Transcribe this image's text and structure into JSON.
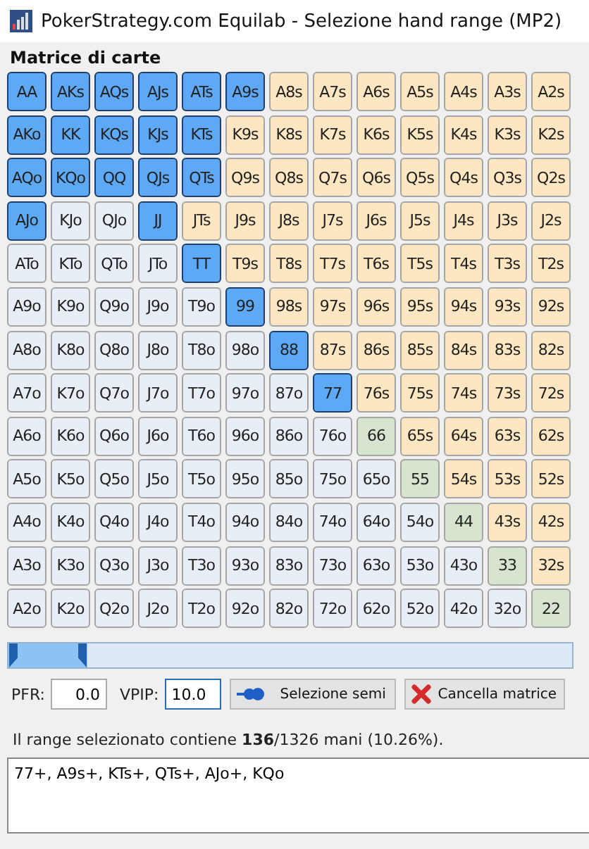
{
  "window": {
    "title": "PokerStrategy.com Equilab - Selezione hand range (MP2)"
  },
  "matrix": {
    "title": "Matrice di carte",
    "rows": [
      {
        "cells": [
          {
            "label": "AA",
            "kind": "pair",
            "selected": true
          },
          {
            "label": "AKs",
            "kind": "suited",
            "selected": true
          },
          {
            "label": "AQs",
            "kind": "suited",
            "selected": true
          },
          {
            "label": "AJs",
            "kind": "suited",
            "selected": true
          },
          {
            "label": "ATs",
            "kind": "suited",
            "selected": true
          },
          {
            "label": "A9s",
            "kind": "suited",
            "selected": true
          },
          {
            "label": "A8s",
            "kind": "suited",
            "selected": false
          },
          {
            "label": "A7s",
            "kind": "suited",
            "selected": false
          },
          {
            "label": "A6s",
            "kind": "suited",
            "selected": false
          },
          {
            "label": "A5s",
            "kind": "suited",
            "selected": false
          },
          {
            "label": "A4s",
            "kind": "suited",
            "selected": false
          },
          {
            "label": "A3s",
            "kind": "suited",
            "selected": false
          },
          {
            "label": "A2s",
            "kind": "suited",
            "selected": false
          }
        ]
      },
      {
        "cells": [
          {
            "label": "AKo",
            "kind": "offsuit",
            "selected": true
          },
          {
            "label": "KK",
            "kind": "pair",
            "selected": true
          },
          {
            "label": "KQs",
            "kind": "suited",
            "selected": true
          },
          {
            "label": "KJs",
            "kind": "suited",
            "selected": true
          },
          {
            "label": "KTs",
            "kind": "suited",
            "selected": true
          },
          {
            "label": "K9s",
            "kind": "suited",
            "selected": false
          },
          {
            "label": "K8s",
            "kind": "suited",
            "selected": false
          },
          {
            "label": "K7s",
            "kind": "suited",
            "selected": false
          },
          {
            "label": "K6s",
            "kind": "suited",
            "selected": false
          },
          {
            "label": "K5s",
            "kind": "suited",
            "selected": false
          },
          {
            "label": "K4s",
            "kind": "suited",
            "selected": false
          },
          {
            "label": "K3s",
            "kind": "suited",
            "selected": false
          },
          {
            "label": "K2s",
            "kind": "suited",
            "selected": false
          }
        ]
      },
      {
        "cells": [
          {
            "label": "AQo",
            "kind": "offsuit",
            "selected": true
          },
          {
            "label": "KQo",
            "kind": "offsuit",
            "selected": true
          },
          {
            "label": "QQ",
            "kind": "pair",
            "selected": true
          },
          {
            "label": "QJs",
            "kind": "suited",
            "selected": true
          },
          {
            "label": "QTs",
            "kind": "suited",
            "selected": true
          },
          {
            "label": "Q9s",
            "kind": "suited",
            "selected": false
          },
          {
            "label": "Q8s",
            "kind": "suited",
            "selected": false
          },
          {
            "label": "Q7s",
            "kind": "suited",
            "selected": false
          },
          {
            "label": "Q6s",
            "kind": "suited",
            "selected": false
          },
          {
            "label": "Q5s",
            "kind": "suited",
            "selected": false
          },
          {
            "label": "Q4s",
            "kind": "suited",
            "selected": false
          },
          {
            "label": "Q3s",
            "kind": "suited",
            "selected": false
          },
          {
            "label": "Q2s",
            "kind": "suited",
            "selected": false
          }
        ]
      },
      {
        "cells": [
          {
            "label": "AJo",
            "kind": "offsuit",
            "selected": true
          },
          {
            "label": "KJo",
            "kind": "offsuit",
            "selected": false
          },
          {
            "label": "QJo",
            "kind": "offsuit",
            "selected": false
          },
          {
            "label": "JJ",
            "kind": "pair",
            "selected": true
          },
          {
            "label": "JTs",
            "kind": "suited",
            "selected": false
          },
          {
            "label": "J9s",
            "kind": "suited",
            "selected": false
          },
          {
            "label": "J8s",
            "kind": "suited",
            "selected": false
          },
          {
            "label": "J7s",
            "kind": "suited",
            "selected": false
          },
          {
            "label": "J6s",
            "kind": "suited",
            "selected": false
          },
          {
            "label": "J5s",
            "kind": "suited",
            "selected": false
          },
          {
            "label": "J4s",
            "kind": "suited",
            "selected": false
          },
          {
            "label": "J3s",
            "kind": "suited",
            "selected": false
          },
          {
            "label": "J2s",
            "kind": "suited",
            "selected": false
          }
        ]
      },
      {
        "cells": [
          {
            "label": "ATo",
            "kind": "offsuit",
            "selected": false
          },
          {
            "label": "KTo",
            "kind": "offsuit",
            "selected": false
          },
          {
            "label": "QTo",
            "kind": "offsuit",
            "selected": false
          },
          {
            "label": "JTo",
            "kind": "offsuit",
            "selected": false
          },
          {
            "label": "TT",
            "kind": "pair",
            "selected": true
          },
          {
            "label": "T9s",
            "kind": "suited",
            "selected": false
          },
          {
            "label": "T8s",
            "kind": "suited",
            "selected": false
          },
          {
            "label": "T7s",
            "kind": "suited",
            "selected": false
          },
          {
            "label": "T6s",
            "kind": "suited",
            "selected": false
          },
          {
            "label": "T5s",
            "kind": "suited",
            "selected": false
          },
          {
            "label": "T4s",
            "kind": "suited",
            "selected": false
          },
          {
            "label": "T3s",
            "kind": "suited",
            "selected": false
          },
          {
            "label": "T2s",
            "kind": "suited",
            "selected": false
          }
        ]
      },
      {
        "cells": [
          {
            "label": "A9o",
            "kind": "offsuit",
            "selected": false
          },
          {
            "label": "K9o",
            "kind": "offsuit",
            "selected": false
          },
          {
            "label": "Q9o",
            "kind": "offsuit",
            "selected": false
          },
          {
            "label": "J9o",
            "kind": "offsuit",
            "selected": false
          },
          {
            "label": "T9o",
            "kind": "offsuit",
            "selected": false
          },
          {
            "label": "99",
            "kind": "pair",
            "selected": true
          },
          {
            "label": "98s",
            "kind": "suited",
            "selected": false
          },
          {
            "label": "97s",
            "kind": "suited",
            "selected": false
          },
          {
            "label": "96s",
            "kind": "suited",
            "selected": false
          },
          {
            "label": "95s",
            "kind": "suited",
            "selected": false
          },
          {
            "label": "94s",
            "kind": "suited",
            "selected": false
          },
          {
            "label": "93s",
            "kind": "suited",
            "selected": false
          },
          {
            "label": "92s",
            "kind": "suited",
            "selected": false
          }
        ]
      },
      {
        "cells": [
          {
            "label": "A8o",
            "kind": "offsuit",
            "selected": false
          },
          {
            "label": "K8o",
            "kind": "offsuit",
            "selected": false
          },
          {
            "label": "Q8o",
            "kind": "offsuit",
            "selected": false
          },
          {
            "label": "J8o",
            "kind": "offsuit",
            "selected": false
          },
          {
            "label": "T8o",
            "kind": "offsuit",
            "selected": false
          },
          {
            "label": "98o",
            "kind": "offsuit",
            "selected": false
          },
          {
            "label": "88",
            "kind": "pair",
            "selected": true
          },
          {
            "label": "87s",
            "kind": "suited",
            "selected": false
          },
          {
            "label": "86s",
            "kind": "suited",
            "selected": false
          },
          {
            "label": "85s",
            "kind": "suited",
            "selected": false
          },
          {
            "label": "84s",
            "kind": "suited",
            "selected": false
          },
          {
            "label": "83s",
            "kind": "suited",
            "selected": false
          },
          {
            "label": "82s",
            "kind": "suited",
            "selected": false
          }
        ]
      },
      {
        "cells": [
          {
            "label": "A7o",
            "kind": "offsuit",
            "selected": false
          },
          {
            "label": "K7o",
            "kind": "offsuit",
            "selected": false
          },
          {
            "label": "Q7o",
            "kind": "offsuit",
            "selected": false
          },
          {
            "label": "J7o",
            "kind": "offsuit",
            "selected": false
          },
          {
            "label": "T7o",
            "kind": "offsuit",
            "selected": false
          },
          {
            "label": "97o",
            "kind": "offsuit",
            "selected": false
          },
          {
            "label": "87o",
            "kind": "offsuit",
            "selected": false
          },
          {
            "label": "77",
            "kind": "pair",
            "selected": true
          },
          {
            "label": "76s",
            "kind": "suited",
            "selected": false
          },
          {
            "label": "75s",
            "kind": "suited",
            "selected": false
          },
          {
            "label": "74s",
            "kind": "suited",
            "selected": false
          },
          {
            "label": "73s",
            "kind": "suited",
            "selected": false
          },
          {
            "label": "72s",
            "kind": "suited",
            "selected": false
          }
        ]
      },
      {
        "cells": [
          {
            "label": "A6o",
            "kind": "offsuit",
            "selected": false
          },
          {
            "label": "K6o",
            "kind": "offsuit",
            "selected": false
          },
          {
            "label": "Q6o",
            "kind": "offsuit",
            "selected": false
          },
          {
            "label": "J6o",
            "kind": "offsuit",
            "selected": false
          },
          {
            "label": "T6o",
            "kind": "offsuit",
            "selected": false
          },
          {
            "label": "96o",
            "kind": "offsuit",
            "selected": false
          },
          {
            "label": "86o",
            "kind": "offsuit",
            "selected": false
          },
          {
            "label": "76o",
            "kind": "offsuit",
            "selected": false
          },
          {
            "label": "66",
            "kind": "pair",
            "selected": false
          },
          {
            "label": "65s",
            "kind": "suited",
            "selected": false
          },
          {
            "label": "64s",
            "kind": "suited",
            "selected": false
          },
          {
            "label": "63s",
            "kind": "suited",
            "selected": false
          },
          {
            "label": "62s",
            "kind": "suited",
            "selected": false
          }
        ]
      },
      {
        "cells": [
          {
            "label": "A5o",
            "kind": "offsuit",
            "selected": false
          },
          {
            "label": "K5o",
            "kind": "offsuit",
            "selected": false
          },
          {
            "label": "Q5o",
            "kind": "offsuit",
            "selected": false
          },
          {
            "label": "J5o",
            "kind": "offsuit",
            "selected": false
          },
          {
            "label": "T5o",
            "kind": "offsuit",
            "selected": false
          },
          {
            "label": "95o",
            "kind": "offsuit",
            "selected": false
          },
          {
            "label": "85o",
            "kind": "offsuit",
            "selected": false
          },
          {
            "label": "75o",
            "kind": "offsuit",
            "selected": false
          },
          {
            "label": "65o",
            "kind": "offsuit",
            "selected": false
          },
          {
            "label": "55",
            "kind": "pair",
            "selected": false
          },
          {
            "label": "54s",
            "kind": "suited",
            "selected": false
          },
          {
            "label": "53s",
            "kind": "suited",
            "selected": false
          },
          {
            "label": "52s",
            "kind": "suited",
            "selected": false
          }
        ]
      },
      {
        "cells": [
          {
            "label": "A4o",
            "kind": "offsuit",
            "selected": false
          },
          {
            "label": "K4o",
            "kind": "offsuit",
            "selected": false
          },
          {
            "label": "Q4o",
            "kind": "offsuit",
            "selected": false
          },
          {
            "label": "J4o",
            "kind": "offsuit",
            "selected": false
          },
          {
            "label": "T4o",
            "kind": "offsuit",
            "selected": false
          },
          {
            "label": "94o",
            "kind": "offsuit",
            "selected": false
          },
          {
            "label": "84o",
            "kind": "offsuit",
            "selected": false
          },
          {
            "label": "74o",
            "kind": "offsuit",
            "selected": false
          },
          {
            "label": "64o",
            "kind": "offsuit",
            "selected": false
          },
          {
            "label": "54o",
            "kind": "offsuit",
            "selected": false
          },
          {
            "label": "44",
            "kind": "pair",
            "selected": false
          },
          {
            "label": "43s",
            "kind": "suited",
            "selected": false
          },
          {
            "label": "42s",
            "kind": "suited",
            "selected": false
          }
        ]
      },
      {
        "cells": [
          {
            "label": "A3o",
            "kind": "offsuit",
            "selected": false
          },
          {
            "label": "K3o",
            "kind": "offsuit",
            "selected": false
          },
          {
            "label": "Q3o",
            "kind": "offsuit",
            "selected": false
          },
          {
            "label": "J3o",
            "kind": "offsuit",
            "selected": false
          },
          {
            "label": "T3o",
            "kind": "offsuit",
            "selected": false
          },
          {
            "label": "93o",
            "kind": "offsuit",
            "selected": false
          },
          {
            "label": "83o",
            "kind": "offsuit",
            "selected": false
          },
          {
            "label": "73o",
            "kind": "offsuit",
            "selected": false
          },
          {
            "label": "63o",
            "kind": "offsuit",
            "selected": false
          },
          {
            "label": "53o",
            "kind": "offsuit",
            "selected": false
          },
          {
            "label": "43o",
            "kind": "offsuit",
            "selected": false
          },
          {
            "label": "33",
            "kind": "pair",
            "selected": false
          },
          {
            "label": "32s",
            "kind": "suited",
            "selected": false
          }
        ]
      },
      {
        "cells": [
          {
            "label": "A2o",
            "kind": "offsuit",
            "selected": false
          },
          {
            "label": "K2o",
            "kind": "offsuit",
            "selected": false
          },
          {
            "label": "Q2o",
            "kind": "offsuit",
            "selected": false
          },
          {
            "label": "J2o",
            "kind": "offsuit",
            "selected": false
          },
          {
            "label": "T2o",
            "kind": "offsuit",
            "selected": false
          },
          {
            "label": "92o",
            "kind": "offsuit",
            "selected": false
          },
          {
            "label": "82o",
            "kind": "offsuit",
            "selected": false
          },
          {
            "label": "72o",
            "kind": "offsuit",
            "selected": false
          },
          {
            "label": "62o",
            "kind": "offsuit",
            "selected": false
          },
          {
            "label": "52o",
            "kind": "offsuit",
            "selected": false
          },
          {
            "label": "42o",
            "kind": "offsuit",
            "selected": false
          },
          {
            "label": "32o",
            "kind": "offsuit",
            "selected": false
          },
          {
            "label": "22",
            "kind": "pair",
            "selected": false
          }
        ]
      }
    ]
  },
  "slider": {
    "level": 0.14
  },
  "controls": {
    "pfr_label": "PFR:",
    "pfr_value": "0.0",
    "vpip_label": "VPIP:",
    "vpip_value": "10.0",
    "suits_button": "Selezione semi",
    "clear_button": "Cancella matrice"
  },
  "summary": "Il range selezionato contiene **136**/1326 mani (10.26%).",
  "range_text": "77+, A9s+, KTs+, QTs+, AJo+, KQo"
}
